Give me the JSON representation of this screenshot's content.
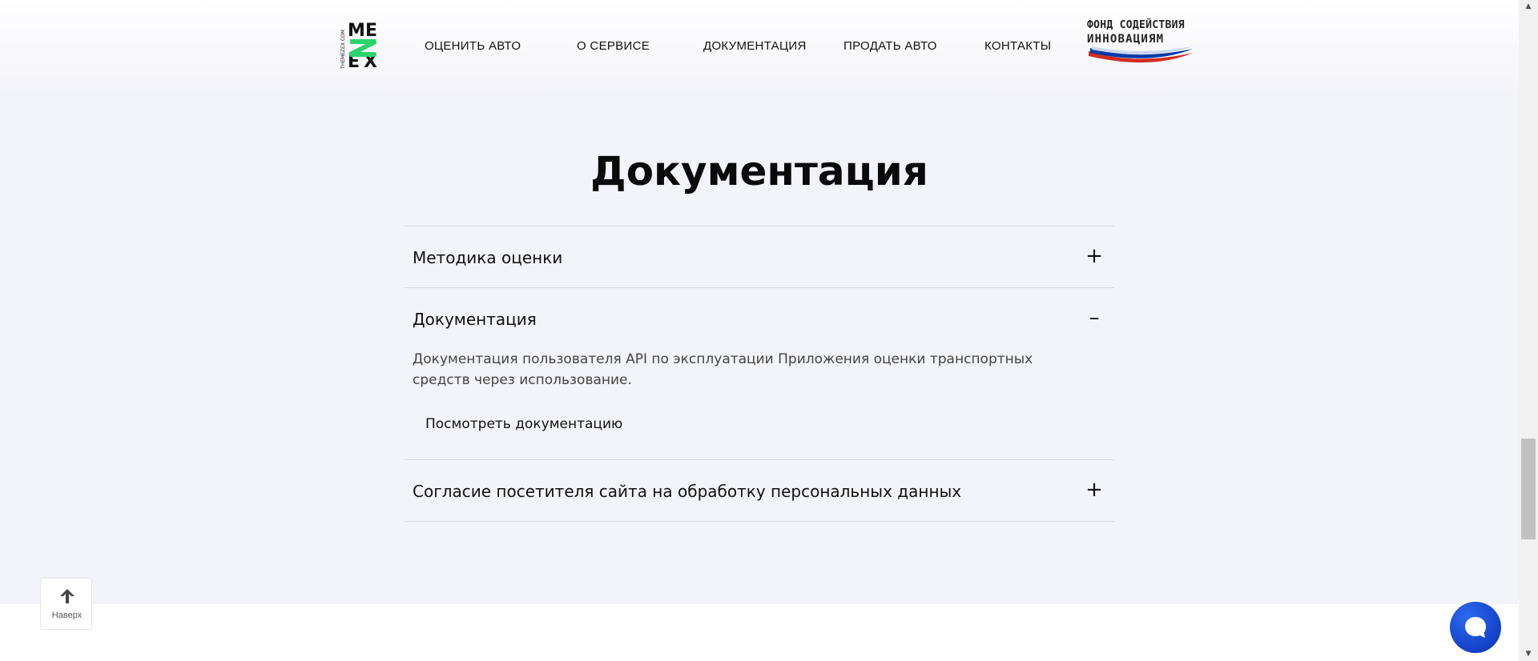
{
  "brand": {
    "logo_name": "MEX",
    "logo_vertical_text": "THEMEZEX.COM"
  },
  "nav": {
    "items": [
      {
        "label": "ОЦЕНИТЬ АВТО"
      },
      {
        "label": "О СЕРВИСЕ"
      },
      {
        "label": "ДОКУМЕНТАЦИЯ"
      },
      {
        "label": "ПРОДАТЬ АВТО"
      },
      {
        "label": "КОНТАКТЫ"
      }
    ]
  },
  "partner": {
    "line1": "ФОНД СОДЕЙСТВИЯ",
    "line2": "ИННОВАЦИЯМ"
  },
  "page": {
    "title": "Документация"
  },
  "accordion": {
    "items": [
      {
        "title": "Методика оценки",
        "toggle": "+"
      },
      {
        "title": "Документация",
        "toggle": "–",
        "text": "Документация пользователя API по эксплуатации Приложения оценки транспортных средств через использование.",
        "link": "Посмотреть документацию"
      },
      {
        "title": "Согласие посетителя сайта на обработку персональных данных",
        "toggle": "+"
      }
    ]
  },
  "scroll_up": {
    "label": "Наверх"
  },
  "colors": {
    "hero_bg": "#f3f3fa",
    "accent_green": "#2bd46a",
    "chat_blue": "#0b2fb5",
    "flag_red": "#d52b1e",
    "flag_blue": "#0039a6"
  }
}
